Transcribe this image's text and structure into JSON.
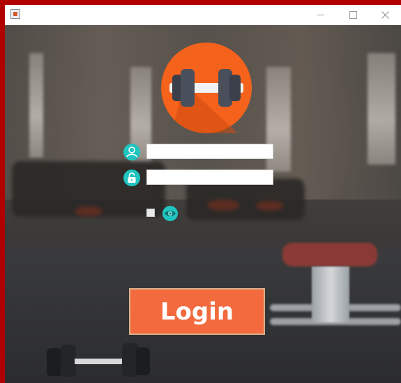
{
  "window": {
    "app_icon": "java-icon",
    "controls": {
      "minimize": "minimize-icon",
      "maximize": "maximize-icon",
      "close": "close-icon"
    }
  },
  "login_form": {
    "logo": "dumbbell-icon",
    "username": {
      "icon": "user-icon",
      "value": "",
      "placeholder": ""
    },
    "password": {
      "icon": "lock-icon",
      "value": "",
      "placeholder": ""
    },
    "show_password": {
      "checked": false,
      "icon": "eye-icon"
    },
    "login_button_label": "Login",
    "colors": {
      "accent": "#f26a3d",
      "logo_circle": "#f4621c",
      "icon_teal": "#20c4c0"
    }
  }
}
